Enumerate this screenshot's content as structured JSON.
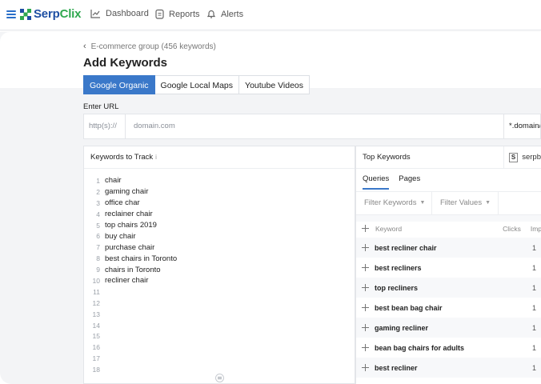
{
  "nav": {
    "brand_serp": "Serp",
    "brand_clix": "Clix",
    "items": [
      {
        "label": "Dashboard",
        "icon": "chart-icon"
      },
      {
        "label": "Reports",
        "icon": "report-icon"
      },
      {
        "label": "Alerts",
        "icon": "bell-icon"
      }
    ]
  },
  "header": {
    "breadcrumb": "E-commerce group (456 keywords)",
    "title": "Add Keywords",
    "tabs": [
      {
        "label": "Google Organic",
        "active": true
      },
      {
        "label": "Google Local Maps",
        "active": false
      },
      {
        "label": "Youtube Videos",
        "active": false
      }
    ]
  },
  "url": {
    "label": "Enter URL",
    "protocol_placeholder": "http(s)://",
    "domain_placeholder": "domain.com",
    "match_option": "*.domain/"
  },
  "keywords_panel": {
    "title": "Keywords to Track",
    "info_icon": "i",
    "lines": [
      {
        "n": "1",
        "text": "chair"
      },
      {
        "n": "2",
        "text": "gaming chair"
      },
      {
        "n": "3",
        "text": "office char"
      },
      {
        "n": "4",
        "text": "reclainer chair"
      },
      {
        "n": "5",
        "text": "top chairs 2019"
      },
      {
        "n": "6",
        "text": "buy chair"
      },
      {
        "n": "7",
        "text": "purchase chair"
      },
      {
        "n": "8",
        "text": "best chairs in Toronto"
      },
      {
        "n": "9",
        "text": "chairs in Toronto"
      },
      {
        "n": "10",
        "text": "recliner chair"
      },
      {
        "n": "11",
        "text": ""
      },
      {
        "n": "12",
        "text": ""
      },
      {
        "n": "13",
        "text": ""
      },
      {
        "n": "14",
        "text": ""
      },
      {
        "n": "15",
        "text": ""
      },
      {
        "n": "16",
        "text": ""
      },
      {
        "n": "17",
        "text": ""
      },
      {
        "n": "18",
        "text": ""
      }
    ]
  },
  "top_keywords": {
    "title": "Top Keywords",
    "site_badge": "S",
    "site": "serpb",
    "tabs": [
      {
        "label": "Queries",
        "active": true
      },
      {
        "label": "Pages",
        "active": false
      }
    ],
    "filters": [
      "Filter Keywords",
      "Filter Values"
    ],
    "columns": {
      "keyword": "Keyword",
      "clicks": "Clicks",
      "impressions": "Imp"
    },
    "rows": [
      {
        "keyword": "best recliner chair",
        "clicks": "1"
      },
      {
        "keyword": "best recliners",
        "clicks": "1"
      },
      {
        "keyword": "top recliners",
        "clicks": "1"
      },
      {
        "keyword": "best bean bag chair",
        "clicks": "1"
      },
      {
        "keyword": "gaming recliner",
        "clicks": "1"
      },
      {
        "keyword": "bean bag chairs for adults",
        "clicks": "1"
      },
      {
        "keyword": "best recliner",
        "clicks": "1"
      }
    ]
  },
  "colors": {
    "accent": "#3a78c9",
    "brand_blue": "#1e4fa3",
    "brand_green": "#2fa84f"
  }
}
